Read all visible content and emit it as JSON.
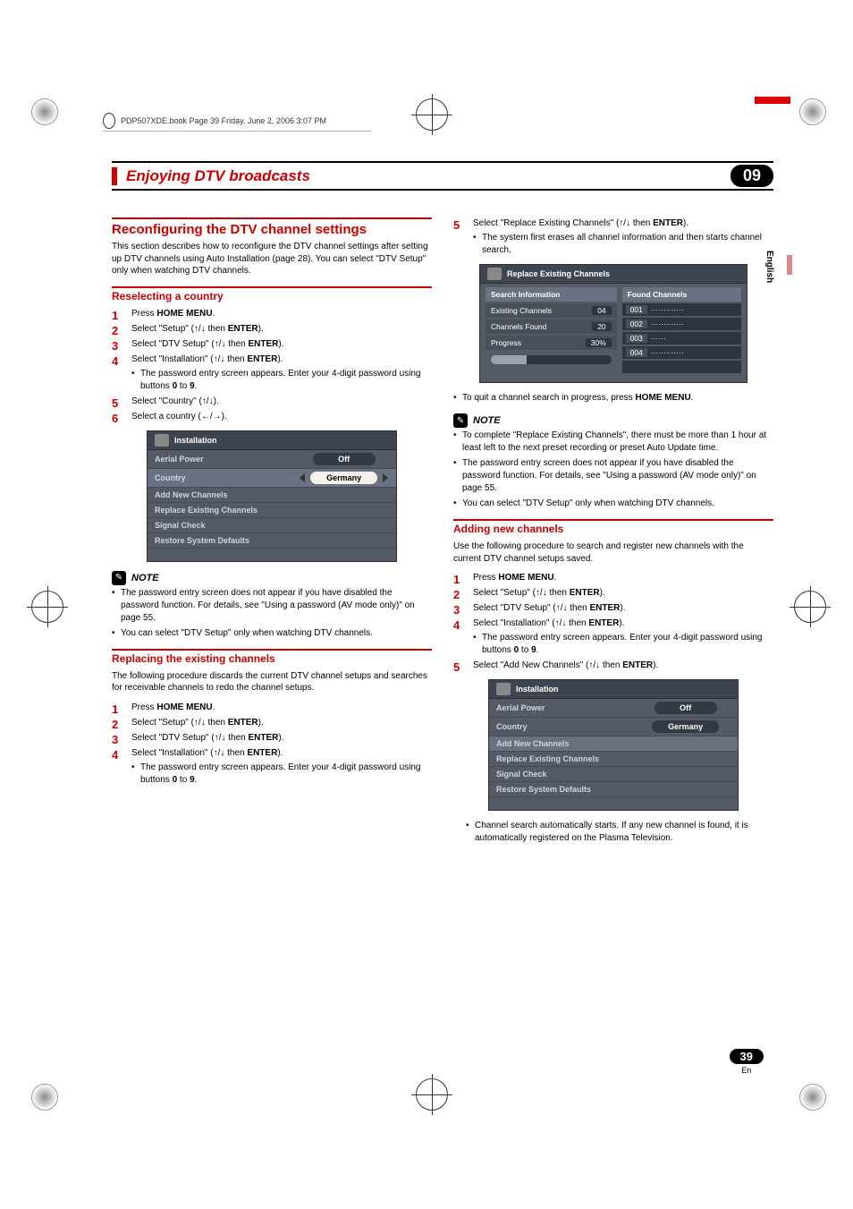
{
  "book_header": "PDP507XDE.book  Page 39  Friday, June 2, 2006  3:07 PM",
  "chapter": {
    "title": "Enjoying DTV broadcasts",
    "num": "09"
  },
  "side_tab": "English",
  "page_badge": {
    "num": "39",
    "lang": "En"
  },
  "h_reconfig": "Reconfiguring the DTV channel settings",
  "p_reconfig": "This section describes how to reconfigure the DTV channel settings after setting up DTV channels using Auto Installation (page 28). You can select \"DTV Setup\" only when watching DTV channels.",
  "h_reselect": "Reselecting a country",
  "steps_reselect": [
    "Press <b>HOME MENU</b>.",
    "Select \"Setup\" (<span class='arrow'>↑</span>/<span class='arrow'>↓</span> then <b>ENTER</b>).",
    "Select \"DTV Setup\" (<span class='arrow'>↑</span>/<span class='arrow'>↓</span> then <b>ENTER</b>).",
    "Select \"Installation\" (<span class='arrow'>↑</span>/<span class='arrow'>↓</span> then <b>ENTER</b>).",
    "Select  \"Country\" (<span class='arrow'>↑</span>/<span class='arrow'>↓</span>).",
    "Select a country (<span class='arrow'>←</span>/<span class='arrow'>→</span>)."
  ],
  "pw_sub": "The password entry screen appears. Enter your 4-digit password using buttons <b>0</b> to <b>9</b>.",
  "osd_install": {
    "title": "Installation",
    "rows": [
      {
        "label": "Aerial Power",
        "value": "Off",
        "pill": true
      },
      {
        "label": "Country",
        "value": "Germany",
        "pill": true,
        "hi": true,
        "arrows": true
      },
      {
        "label": "Add New Channels"
      },
      {
        "label": "Replace Existing Channels"
      },
      {
        "label": "Signal Check"
      },
      {
        "label": "Restore System Defaults"
      }
    ]
  },
  "note_label": "NOTE",
  "notes1": [
    "The password entry screen does not appear if you have disabled the password function. For details, see \"Using a password (AV mode only)\" on page 55.",
    "You can select \"DTV Setup\" only when watching DTV channels."
  ],
  "h_replace": "Replacing the existing channels",
  "p_replace": "The following procedure discards the current DTV channel setups and searches for receivable channels to redo the channel setups.",
  "steps_replace": [
    "Press <b>HOME MENU</b>.",
    "Select \"Setup\" (<span class='arrow'>↑</span>/<span class='arrow'>↓</span> then <b>ENTER</b>).",
    "Select \"DTV Setup\" (<span class='arrow'>↑</span>/<span class='arrow'>↓</span> then <b>ENTER</b>).",
    "Select \"Installation\" (<span class='arrow'>↑</span>/<span class='arrow'>↓</span> then <b>ENTER</b>)."
  ],
  "col2_step5": "Select \"Replace Existing Channels\" (<span class='arrow'>↑</span>/<span class='arrow'>↓</span> then <b>ENTER</b>).",
  "col2_step5_sub": "The system first erases all channel information and then starts channel search.",
  "osd_replace": {
    "title": "Replace Existing Channels",
    "left_header": "Search Information",
    "right_header": "Found Channels",
    "left_rows": [
      {
        "label": "Existing Channels",
        "v": "04"
      },
      {
        "label": "Channels Found",
        "v": "20"
      },
      {
        "label": "Progress",
        "v": "30%"
      }
    ],
    "right_rows": [
      {
        "n": "001",
        "t": "·············"
      },
      {
        "n": "002",
        "t": "·············"
      },
      {
        "n": "003",
        "t": "······"
      },
      {
        "n": "004",
        "t": "·············"
      }
    ]
  },
  "quit_note": "To quit a channel search in progress, press <b>HOME MENU</b>.",
  "notes2": [
    "To complete \"Replace Existing Channels\", there must be more than 1 hour at least left to the next preset recording or preset Auto Update time.",
    "The password entry screen does not appear if you have disabled the password function. For details, see \"Using a password (AV mode only)\" on page 55.",
    "You can select \"DTV Setup\" only when watching DTV channels."
  ],
  "h_add": "Adding new channels",
  "p_add": "Use the following procedure to search and register new channels with the current DTV channel setups saved.",
  "steps_add": [
    "Press <b>HOME MENU</b>.",
    "Select \"Setup\" (<span class='arrow'>↑</span>/<span class='arrow'>↓</span> then <b>ENTER</b>).",
    "Select \"DTV Setup\" (<span class='arrow'>↑</span>/<span class='arrow'>↓</span> then <b>ENTER</b>).",
    "Select \"Installation\" (<span class='arrow'>↑</span>/<span class='arrow'>↓</span> then <b>ENTER</b>).",
    "Select  \"Add New Channels\" (<span class='arrow'>↑</span>/<span class='arrow'>↓</span> then <b>ENTER</b>)."
  ],
  "osd_install2": {
    "title": "Installation",
    "rows": [
      {
        "label": "Aerial Power",
        "value": "Off",
        "pill": true
      },
      {
        "label": "Country",
        "value": "Germany",
        "pill": true
      },
      {
        "label": "Add New Channels",
        "hi": true
      },
      {
        "label": "Replace Existing Channels"
      },
      {
        "label": "Signal Check"
      },
      {
        "label": "Restore System Defaults"
      }
    ]
  },
  "add_sub": "Channel search automatically starts. If any new channel is found, it is automatically registered on the Plasma Television."
}
